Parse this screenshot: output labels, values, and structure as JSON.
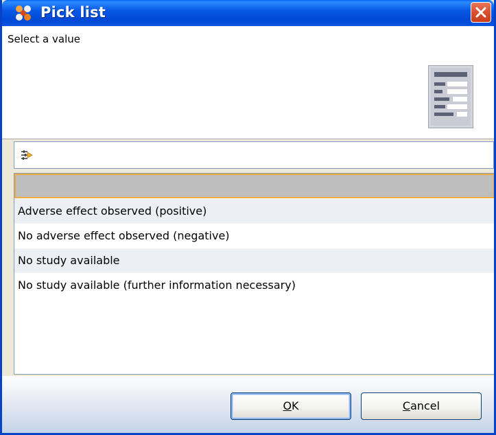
{
  "window": {
    "title": "Pick list",
    "close_label": "close"
  },
  "header": {
    "prompt": "Select a value"
  },
  "filter": {
    "value": "",
    "placeholder": ""
  },
  "list": {
    "items": [
      "",
      "Adverse effect observed (positive)",
      "No adverse effect observed (negative)",
      "No study available",
      "No study available (further information necessary)"
    ],
    "selected_index": 0
  },
  "buttons": {
    "ok": {
      "mnemonic": "O",
      "rest": "K"
    },
    "cancel": {
      "mnemonic": "C",
      "rest": "ancel"
    }
  },
  "colors": {
    "titlebar": "#0859e6",
    "selection_fill": "#bebebe",
    "selection_border": "#f0ab3a",
    "alt_row": "#ecf0f5"
  }
}
